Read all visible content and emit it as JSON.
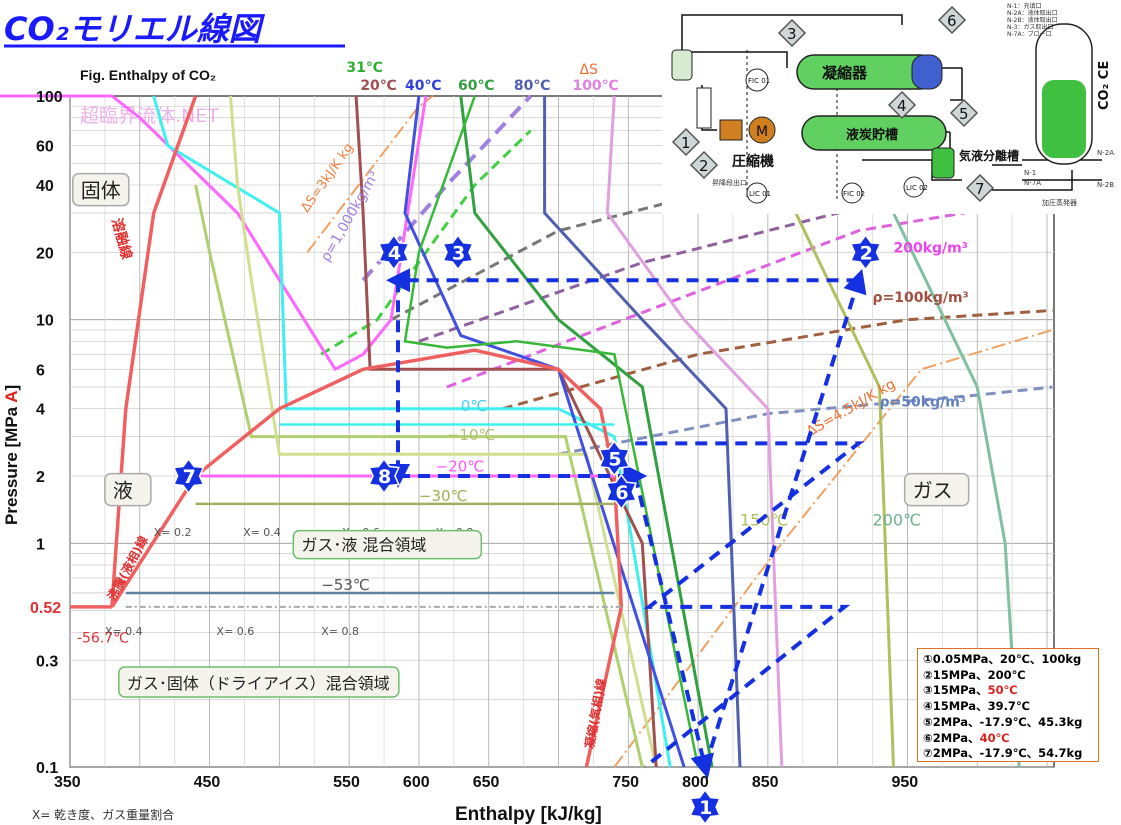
{
  "title": "CO₂モリエル線図",
  "fig_caption": "Fig. Enthalpy of CO₂",
  "watermark": "超臨界流体.NET",
  "axes": {
    "x_label": "Enthalpy [kJ/kg]",
    "y_label_main": "Pressure [MPa ",
    "y_label_unit": "A",
    "y_label_end": "]",
    "x_ticks": [
      "350",
      "450",
      "550",
      "600",
      "650",
      "750",
      "800",
      "850",
      "950"
    ],
    "y_ticks": [
      "100",
      "60",
      "40",
      "20",
      "10",
      "6",
      "4",
      "2",
      "1",
      "0.52",
      "0.3",
      "0.1"
    ]
  },
  "chart_data": {
    "type": "line",
    "x_unit": "kJ/kg",
    "y_unit": "MPa",
    "y_scale": "log",
    "xlim": [
      350,
      1055
    ],
    "ylim": [
      0.1,
      100
    ],
    "cycle_points": [
      {
        "id": "1",
        "h": 805,
        "p": 0.05
      },
      {
        "id": "2",
        "h": 915,
        "p": 15
      },
      {
        "id": "3",
        "h": 630,
        "p": 15
      },
      {
        "id": "4",
        "h": 585,
        "p": 15
      },
      {
        "id": "5",
        "h": 735,
        "p": 2
      },
      {
        "id": "6",
        "h": 755,
        "p": 2
      },
      {
        "id": "7",
        "h": 435,
        "p": 2
      },
      {
        "id": "8",
        "h": 585,
        "p": 2
      }
    ]
  },
  "labels": {
    "phase_solid": "固体",
    "phase_liquid": "液",
    "phase_gas": "ガス",
    "region_gas_liquid": "ガス･液 混合領域",
    "region_gas_solid": "ガス･固体（ドライアイス）混合領域",
    "melting_line": "溶融線",
    "boiling_line": "沸騰(液相)線",
    "condensation_line": "凝縮(気相)線",
    "quality_note": "X= 乾き度、ガス重量割合",
    "triple_point_temp": "-56.7℃",
    "temp_31": "31℃",
    "temp_20": "20℃",
    "temp_40": "40℃",
    "temp_60": "60℃",
    "temp_80": "80℃",
    "temp_100": "100℃",
    "temp_0": "0℃",
    "temp_m10": "−10℃",
    "temp_m20": "−20℃",
    "temp_m30": "−30℃",
    "temp_m53": "−53℃",
    "temp_150": "150℃",
    "temp_200": "200℃",
    "rho_1000": "ρ=1,000kg/m³",
    "rho_200": "200kg/m³",
    "rho_100": "ρ=100kg/m³",
    "rho_50": "ρ=50kg/m³",
    "ds_3": "ΔS=3kJ/K kg",
    "ds_45": "ΔS=4.5kJ/K kg",
    "ds_top": "ΔS",
    "x_02": "X= 0.2",
    "x_04": "X= 0.4",
    "x_06": "X= 0.6",
    "x_08": "X= 0.8",
    "x_04b": "X= 0.4",
    "x_06b": "X= 0.6",
    "x_08b": "X= 0.8"
  },
  "legend": [
    {
      "text": "①0.05MPa、20℃、100kg"
    },
    {
      "text": "②15MPa、200℃"
    },
    {
      "pre": "③15MPa、",
      "hl": "50℃",
      "post": ""
    },
    {
      "text": "④15MPa、39.7℃"
    },
    {
      "text": "⑤2MPa、-17.9℃、45.3kg"
    },
    {
      "pre": "⑥2MPa、",
      "hl": "40℃",
      "post": ""
    },
    {
      "text": "⑦2MPa、-17.9℃、54.7kg"
    }
  ],
  "schematic": {
    "condenser": "凝縮器",
    "receiver": "液炭貯槽",
    "compressor": "圧縮機",
    "separator": "気液分離槽",
    "motor": "M",
    "fic1": "FIC 01",
    "fic2": "FIC 02",
    "lic1": "LIC 01",
    "lic2": "LIC 02",
    "outlet": "昇降段出口",
    "vessel_label": "CO₂ CE",
    "n_list": "N-1：充填口\nN-2A：液体取出口\nN-2B：液体取出口\nN-3：ガス取出口\nN-7A：ブロー口",
    "heater": "加圧蒸発器",
    "n2a": "N-2A",
    "n2b": "N-2B",
    "n1": "N-1",
    "n7a": "N-7A",
    "callouts": [
      "1",
      "2",
      "3",
      "4",
      "5",
      "6",
      "7"
    ]
  },
  "colors": {
    "cycle": "#1530e0",
    "saturation": "#f06060",
    "isotherm_31": "#38b838",
    "isotherm_20": "#a05040",
    "isotherm_40": "#4050e0",
    "isotherm_60": "#30a040",
    "isotherm_80": "#5060b0",
    "isotherm_100": "#e080e0",
    "accent": "#f07030"
  }
}
